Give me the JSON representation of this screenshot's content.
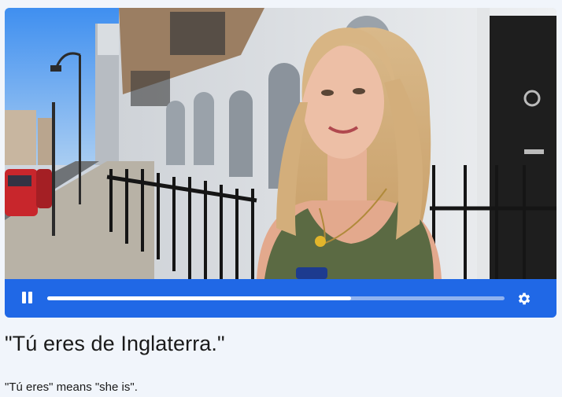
{
  "video": {
    "progress_fraction": 0.665,
    "pause_icon": "pause-icon",
    "settings_icon": "gear-icon",
    "accent_color": "#2068e6"
  },
  "caption": {
    "sentence": "\"Tú eres de Inglaterra.\"",
    "explanation": "\"Tú eres\" means \"she is\"."
  }
}
